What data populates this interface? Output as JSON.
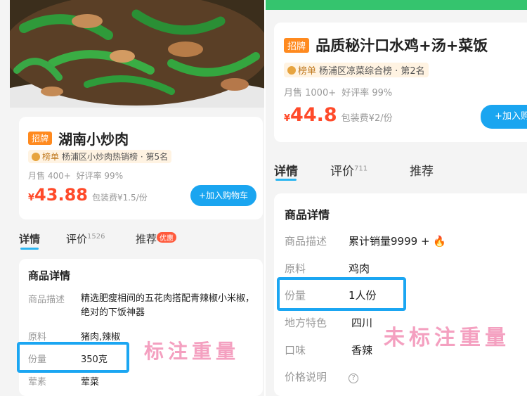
{
  "left": {
    "tag": "招牌",
    "title": "湖南小炒肉",
    "rank_label": "榜单",
    "rank_text": "杨浦区小炒肉热销榜 · 第5名",
    "monthly_sales": "月售 400+",
    "rating": "好评率 99%",
    "currency": "¥",
    "price": "43.88",
    "packing_fee": "包装费¥1.5/份",
    "add_to_cart": "+加入购物车",
    "tabs": [
      {
        "label": "详情"
      },
      {
        "label": "评价",
        "count": "1526"
      },
      {
        "label": "推荐",
        "badge": "优惠"
      }
    ],
    "section_title": "商品详情",
    "rows": [
      {
        "label": "商品描述",
        "value": "精选肥瘦相间的五花肉搭配青辣椒小米椒，绝对的下饭神器"
      },
      {
        "label": "原料",
        "value": "猪肉,辣椒"
      },
      {
        "label": "份量",
        "value": "350克"
      },
      {
        "label": "荤素",
        "value": "荤菜"
      }
    ],
    "annotation": "标注重量"
  },
  "right": {
    "tag": "招牌",
    "title": "品质秘汁口水鸡+汤+菜饭",
    "rank_label": "榜单",
    "rank_text": "杨浦区凉菜综合榜 · 第2名",
    "monthly_sales": "月售 1000+",
    "rating": "好评率 99%",
    "currency": "¥",
    "price": "44.8",
    "packing_fee": "包装费¥2/份",
    "add_to_cart": "+加入购",
    "tabs": [
      {
        "label": "详情"
      },
      {
        "label": "评价",
        "count": "711"
      },
      {
        "label": "推荐"
      }
    ],
    "section_title": "商品详情",
    "rows": [
      {
        "label": "商品描述",
        "value": "累计销量9999 + 🔥"
      },
      {
        "label": "原料",
        "value": "鸡肉"
      },
      {
        "label": "份量",
        "value": "1人份"
      },
      {
        "label": "地方特色",
        "value": "四川"
      },
      {
        "label": "口味",
        "value": "香辣"
      },
      {
        "label": "价格说明",
        "value": "?"
      }
    ],
    "annotation": "未标注重量"
  },
  "colors": {
    "accent": "#1aa5f0",
    "price": "#ff4a2a",
    "tag": "#ff8a1f",
    "annotation": "#f4a0c0",
    "highlight": "#1ba6f2"
  }
}
